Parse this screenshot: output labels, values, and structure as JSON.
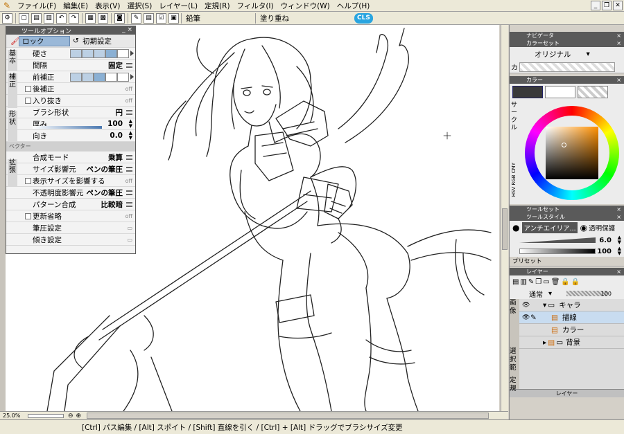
{
  "menu": [
    "ファイル(F)",
    "編集(E)",
    "表示(V)",
    "選択(S)",
    "レイヤー(L)",
    "定規(R)",
    "フィルタ(I)",
    "ウィンドウ(W)",
    "ヘルプ(H)"
  ],
  "toolbar": {
    "tool_name": "鉛筆",
    "blend_mode": "塗り重ね",
    "logo": "CLS"
  },
  "tool_option": {
    "title": "ツールオプション",
    "lock_label": "ロック",
    "reset_label": "初期設定",
    "categories": {
      "basic": "基本",
      "correction": "補正",
      "shape": "形状",
      "extend": "拡張"
    },
    "rows": {
      "hardness": "硬さ",
      "interval": "間隔",
      "interval_value": "固定",
      "pre_correction": "前補正",
      "post_correction": "後補正",
      "taper": "入り抜き",
      "brush_shape": "ブラシ形状",
      "brush_shape_value": "円",
      "thickness": "厚み",
      "thickness_value": "100",
      "direction": "向き",
      "direction_value": "0.0",
      "vector": "ベクター",
      "blend_mode": "合成モード",
      "blend_mode_value": "乗算",
      "size_source": "サイズ影響元",
      "size_source_value": "ペンの筆圧",
      "show_size_effect": "表示サイズを影響する",
      "opacity_source": "不透明度影響元",
      "opacity_source_value": "ペンの筆圧",
      "pattern_blend": "パターン合成",
      "pattern_blend_value": "比較暗",
      "skip_update": "更新省略",
      "pressure_settings": "筆圧設定",
      "tilt_settings": "傾き設定",
      "off": "off"
    }
  },
  "right_panel": {
    "navigator": "ナビゲータ",
    "color_set": "カラーセット",
    "color_set_value": "オリジナル",
    "color_label": "カ",
    "color": "カラー",
    "circle_tab": "サークル",
    "tabs": "HSV RGB CMY",
    "tool_set": "ツールセット",
    "tool_style": "ツールスタイル",
    "style_anti": "アンチエイリア...",
    "style_transparent": "透明保護",
    "size_value": "6.0",
    "opacity_value": "100",
    "preset": "プリセット",
    "layer": "レイヤー",
    "layer_mode": "通常",
    "layer_opacity": "100",
    "side_tabs": {
      "image": "画像",
      "select": "選択範",
      "ruler": "定規"
    },
    "layers": [
      "キャラ",
      "描線",
      "カラー",
      "背景"
    ],
    "layer_tab": "レイヤー"
  },
  "zoom": "25.0%",
  "status": "[Ctrl] パス編集 / [Alt] スポイト / [Shift] 直線を引く / [Ctrl] + [Alt] ドラッグでブラシサイズ変更",
  "colors": {
    "main": "#3a3a3a",
    "sub": "#ffffff",
    "hue_wheel": "conic"
  }
}
